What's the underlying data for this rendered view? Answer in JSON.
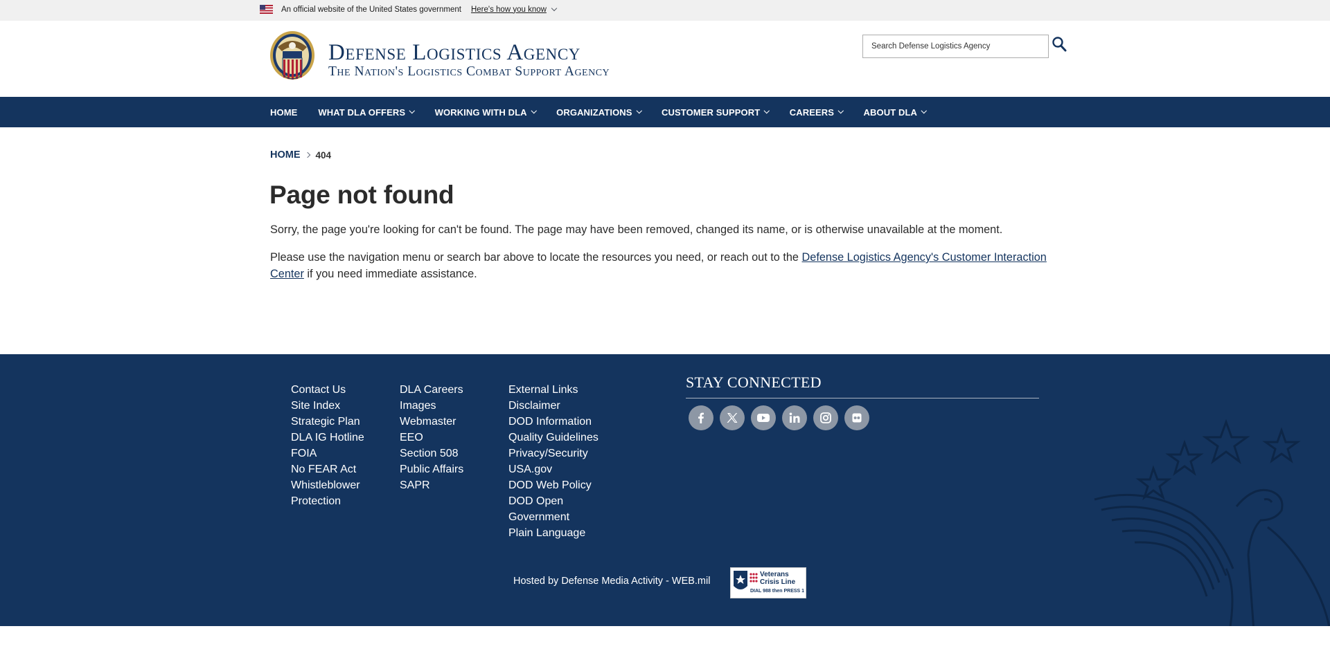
{
  "gov_banner": {
    "text": "An official website of the United States government",
    "link": "Here's how you know"
  },
  "header": {
    "title": "Defense Logistics Agency",
    "subtitle": "The Nation's Logistics Combat Support Agency",
    "search_placeholder": "Search Defense Logistics Agency"
  },
  "nav": {
    "items": [
      {
        "label": "Home",
        "dropdown": false
      },
      {
        "label": "What DLA Offers",
        "dropdown": true
      },
      {
        "label": "Working with DLA",
        "dropdown": true
      },
      {
        "label": "Organizations",
        "dropdown": true
      },
      {
        "label": "Customer Support",
        "dropdown": true
      },
      {
        "label": "Careers",
        "dropdown": true
      },
      {
        "label": "About DLA",
        "dropdown": true
      }
    ]
  },
  "breadcrumb": {
    "home": "HOME",
    "current": "404"
  },
  "main": {
    "title": "Page not found",
    "p1": "Sorry, the page you're looking for can't be found. The page may have been removed, changed its name, or is otherwise unavailable at the moment.",
    "p2_before": "Please use the navigation menu or search bar above to locate the resources you need, or reach out to the ",
    "p2_link": "Defense Logistics Agency's Customer Interaction Center",
    "p2_after": " if you need immediate assistance."
  },
  "footer": {
    "col1": [
      "Contact Us",
      "Site Index",
      "Strategic Plan",
      "DLA IG Hotline",
      "FOIA",
      "No FEAR Act",
      "Whistleblower Protection"
    ],
    "col2": [
      "DLA Careers",
      "Images",
      "Webmaster",
      "EEO",
      "Section 508",
      "Public Affairs",
      "SAPR"
    ],
    "col3": [
      "External Links",
      "Disclaimer",
      "DOD Information",
      "Quality Guidelines",
      "Privacy/Security",
      "USA.gov",
      "DOD Web Policy",
      "DOD Open Government",
      "Plain Language"
    ],
    "stay_connected": "STAY CONNECTED",
    "social": [
      "facebook-icon",
      "x-icon",
      "youtube-icon",
      "linkedin-icon",
      "instagram-icon",
      "flickr-icon"
    ],
    "hosted": "Hosted by Defense Media Activity - WEB.mil",
    "vcl": {
      "line1": "Veterans",
      "line2": "Crisis Line",
      "line3": "DIAL 988 then PRESS 1"
    }
  },
  "colors": {
    "navy": "#14345e",
    "banner_bg": "#f0f0f0",
    "social_bg": "#8d97a5"
  }
}
